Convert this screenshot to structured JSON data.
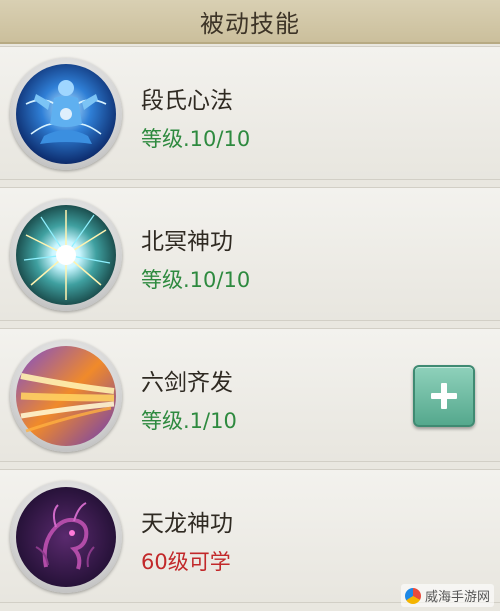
{
  "header": {
    "title": "被动技能"
  },
  "skills": [
    {
      "name": "段氏心法",
      "level": "等级.10/10",
      "icon": "meditating-monk-icon",
      "locked": false,
      "can_upgrade": false
    },
    {
      "name": "北冥神功",
      "level": "等级.10/10",
      "icon": "energy-orb-icon",
      "locked": false,
      "can_upgrade": false
    },
    {
      "name": "六剑齐发",
      "level": "等级.1/10",
      "icon": "sword-beams-icon",
      "locked": false,
      "can_upgrade": true
    },
    {
      "name": "天龙神功",
      "level": "60级可学",
      "icon": "dragon-icon",
      "locked": true,
      "can_upgrade": false
    }
  ],
  "colors": {
    "level_green": "#2e8a3f",
    "locked_red": "#c2282a",
    "header_bg": "#cbbf9c",
    "add_button": "#55a88d"
  },
  "watermark": {
    "text": "威海手游网"
  }
}
